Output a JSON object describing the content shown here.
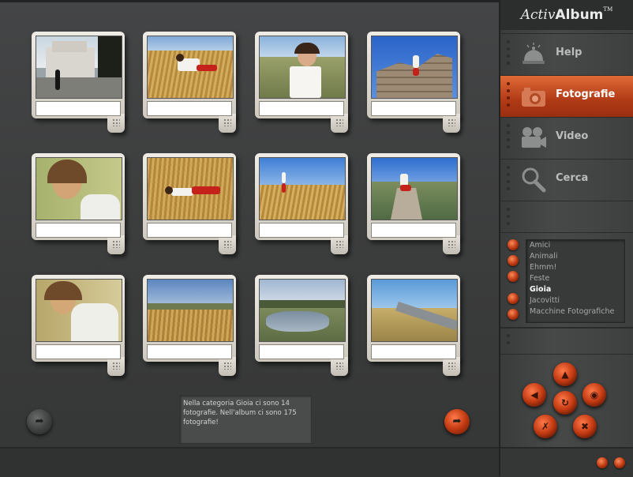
{
  "app": {
    "logo_prefix": "Activ",
    "logo_suffix": "Album",
    "logo_mark": "TM"
  },
  "nav": [
    {
      "label": "Help",
      "icon": "bell-icon"
    },
    {
      "label": "Fotografie",
      "icon": "camera-icon",
      "active": true
    },
    {
      "label": "Video",
      "icon": "video-camera-icon"
    },
    {
      "label": "Cerca",
      "icon": "magnifier-icon"
    }
  ],
  "categories": {
    "items": [
      "Amici",
      "Animali",
      "Ehmm!",
      "Feste",
      "Gioia",
      "Jacovitti",
      "Macchine Fotografiche"
    ],
    "selected": "Gioia"
  },
  "info": {
    "text": "Nella categoria Gioia ci sono 14 fotografie. Nell'album ci sono 175 fotografie!"
  },
  "photos": {
    "captions": [
      "",
      "",
      "",
      "",
      "",
      "",
      "",
      "",
      "",
      "",
      "",
      ""
    ]
  },
  "colors": {
    "accent": "#c23a12",
    "background": "#3a3b3b"
  }
}
